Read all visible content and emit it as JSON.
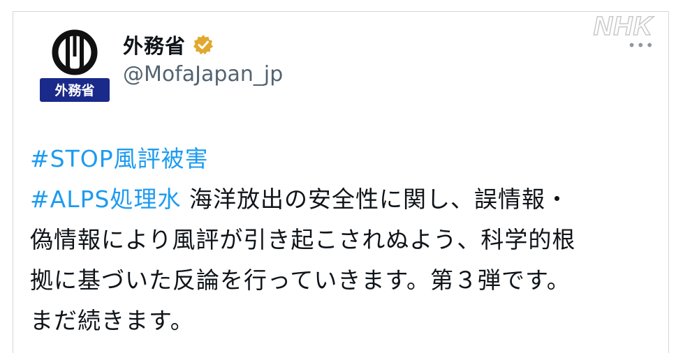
{
  "account": {
    "logo_text": "外務省",
    "display_name": "外務省",
    "handle": "@MofaJapan_jp",
    "verified_icon": "verified-badge-gold"
  },
  "watermark": "NHK",
  "menu_icon": "more-icon",
  "tweet": {
    "hashtag_1": "#STOP風評被害",
    "hashtag_2": "#ALPS処理水",
    "line_2_text": " 海洋放出の安全性に関し、誤情報・",
    "line_3": "偽情報により風評が引き起こされぬよう、科学的根",
    "line_4": "拠に基づいた反論を行っていきます。第３弾です。",
    "line_5": "まだ続きます。"
  },
  "colors": {
    "hashtag": "#1d9bf0",
    "text": "#0f1419",
    "handle": "#536471",
    "logo_band": "#1a2a8a",
    "badge": "#e0a82e"
  }
}
